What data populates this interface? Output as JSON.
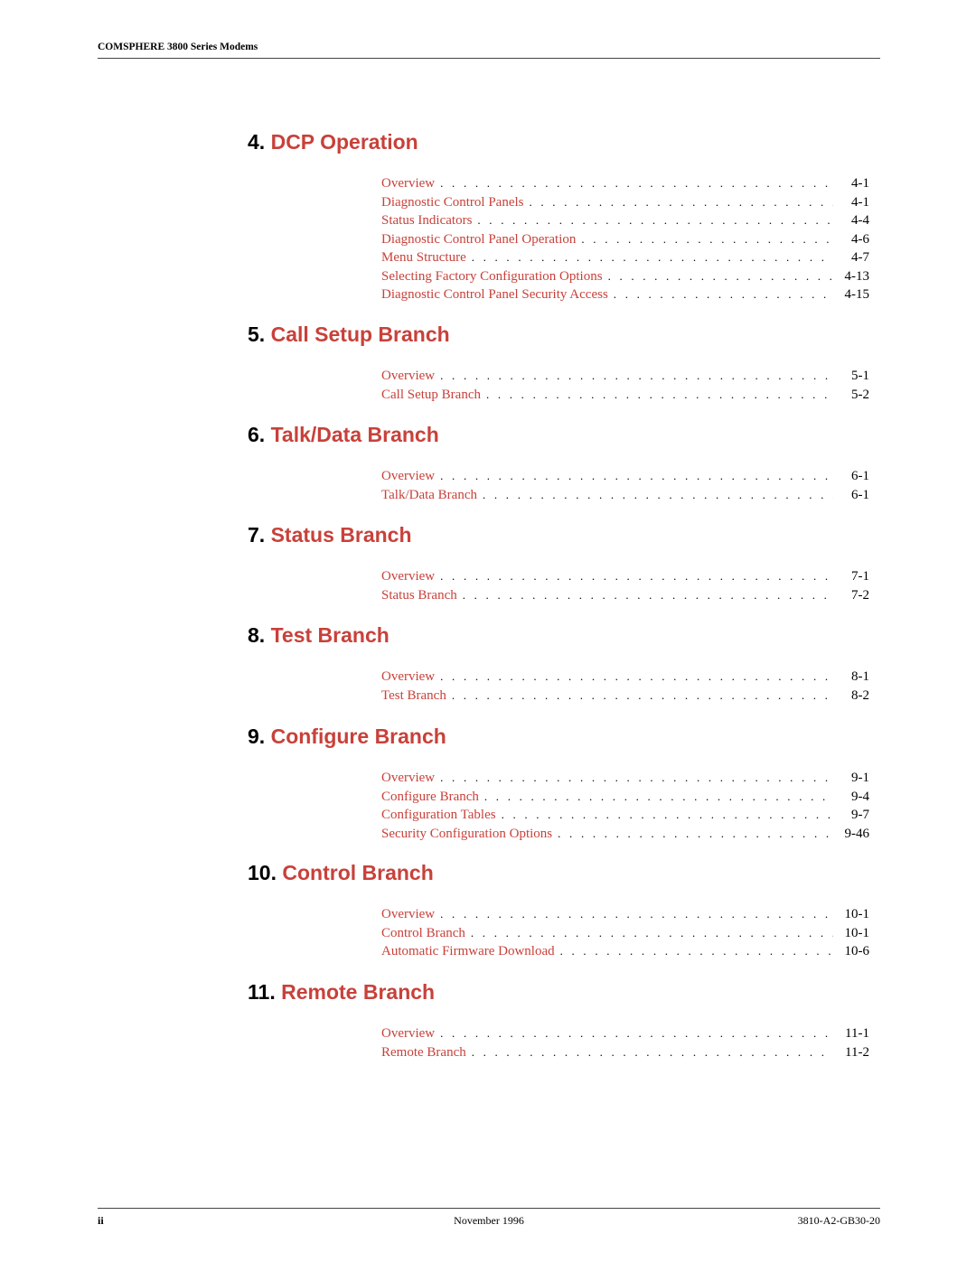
{
  "header": {
    "title": "COMSPHERE 3800 Series Modems"
  },
  "colors": {
    "accent": "#c8413a",
    "text": "#000000",
    "rule": "#444444"
  },
  "sections": [
    {
      "number": "4.",
      "title": "DCP Operation",
      "entries": [
        {
          "label": "Overview",
          "page": "4-1"
        },
        {
          "label": "Diagnostic Control Panels",
          "page": "4-1"
        },
        {
          "label": "Status Indicators",
          "page": "4-4"
        },
        {
          "label": "Diagnostic Control Panel Operation",
          "page": "4-6"
        },
        {
          "label": "Menu Structure",
          "page": "4-7"
        },
        {
          "label": "Selecting Factory Configuration Options",
          "page": "4-13"
        },
        {
          "label": "Diagnostic Control Panel Security Access",
          "page": "4-15"
        }
      ]
    },
    {
      "number": "5.",
      "title": "Call Setup Branch",
      "entries": [
        {
          "label": "Overview",
          "page": "5-1"
        },
        {
          "label": "Call Setup Branch",
          "page": "5-2"
        }
      ]
    },
    {
      "number": "6.",
      "title": "Talk/Data Branch",
      "entries": [
        {
          "label": "Overview",
          "page": "6-1"
        },
        {
          "label": "Talk/Data Branch",
          "page": "6-1"
        }
      ]
    },
    {
      "number": "7.",
      "title": "Status Branch",
      "entries": [
        {
          "label": "Overview",
          "page": "7-1"
        },
        {
          "label": "Status Branch",
          "page": "7-2"
        }
      ]
    },
    {
      "number": "8.",
      "title": "Test Branch",
      "entries": [
        {
          "label": "Overview",
          "page": "8-1"
        },
        {
          "label": "Test Branch",
          "page": "8-2"
        }
      ]
    },
    {
      "number": "9.",
      "title": "Configure Branch",
      "entries": [
        {
          "label": "Overview",
          "page": "9-1"
        },
        {
          "label": "Configure Branch",
          "page": "9-4"
        },
        {
          "label": "Configuration Tables",
          "page": "9-7"
        },
        {
          "label": "Security Configuration Options",
          "page": "9-46"
        }
      ]
    },
    {
      "number": "10.",
      "title": "Control Branch",
      "entries": [
        {
          "label": "Overview",
          "page": "10-1"
        },
        {
          "label": "Control Branch",
          "page": "10-1"
        },
        {
          "label": "Automatic Firmware Download",
          "page": "10-6"
        }
      ]
    },
    {
      "number": "11.",
      "title": "Remote Branch",
      "entries": [
        {
          "label": "Overview",
          "page": "11-1"
        },
        {
          "label": "Remote Branch",
          "page": "11-2"
        }
      ]
    }
  ],
  "footer": {
    "page_number": "ii",
    "date": "November 1996",
    "doc_id": "3810-A2-GB30-20"
  }
}
